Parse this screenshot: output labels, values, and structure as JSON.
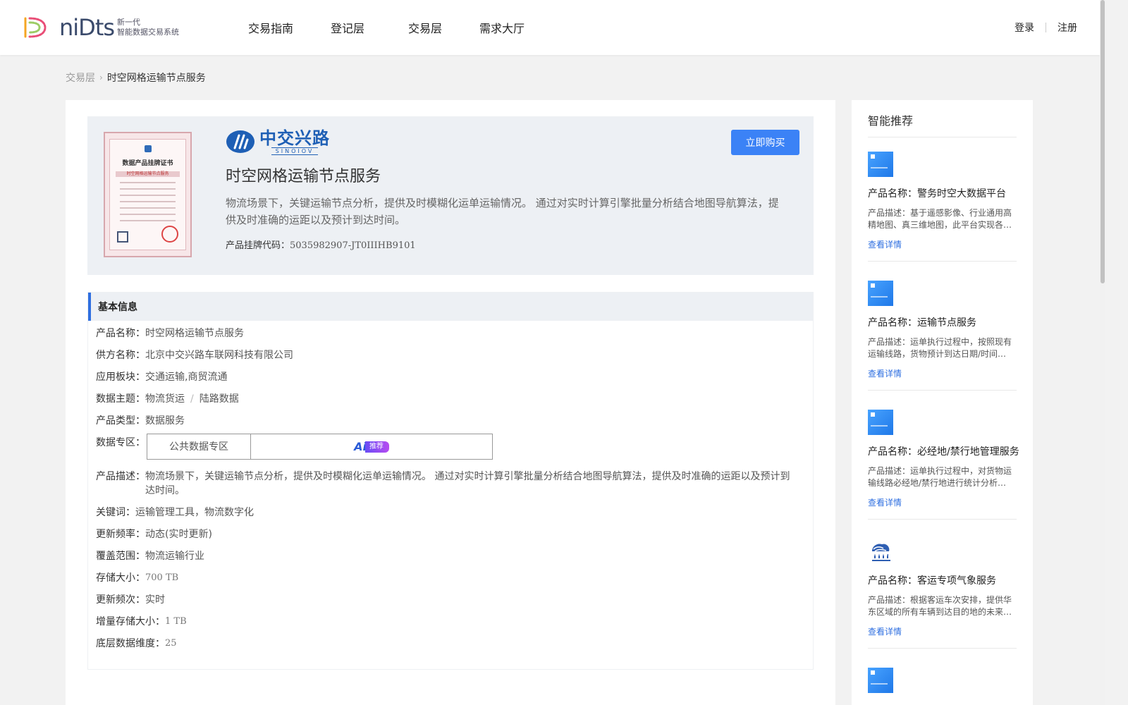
{
  "header": {
    "logo_word": "niDts",
    "logo_sub_1": "新一代",
    "logo_sub_2": "智能数据交易系统",
    "nav": [
      "交易指南",
      "登记层",
      "交易层",
      "需求大厅"
    ],
    "login": "登录",
    "register": "注册"
  },
  "breadcrumb": {
    "parent": "交易层",
    "current": "时空网格运输节点服务"
  },
  "hero": {
    "cert_title": "数据产品挂牌证书",
    "cert_band": "时空网格运输节点服务",
    "brand_cn": "中交兴路",
    "brand_en": "SINOIOV",
    "title": "时空网格运输节点服务",
    "description": "物流场景下，关键运输节点分析，提供及时模糊化运单运输情况。 通过对实时计算引擎批量分析结合地图导航算法，提供及时准确的运距以及预计到达时间。",
    "code_label": "产品挂牌代码：",
    "code_value": "5035982907-JT0IIIHB9101",
    "buy_label": "立即购买"
  },
  "info": {
    "section_title": "基本信息",
    "product_name_label": "产品名称：",
    "product_name": "时空网格运输节点服务",
    "supplier_label": "供方名称：",
    "supplier": "北京中交兴路车联网科技有限公司",
    "sector_label": "应用板块：",
    "sector": "交通运输,商贸流通",
    "theme_label": "数据主题：",
    "theme_1": "物流货运",
    "theme_sep": "/",
    "theme_2": "陆路数据",
    "type_label": "产品类型：",
    "type": "数据服务",
    "zone_label": "数据专区：",
    "zone": "公共数据专区",
    "ai_mark": "Ai",
    "ai_tag": "推荐",
    "desc_label": "产品描述：",
    "desc": "物流场景下，关键运输节点分析，提供及时模糊化运单运输情况。 通过对实时计算引擎批量分析结合地图导航算法，提供及时准确的运距以及预计到达时间。",
    "keywords_label": "关键词：",
    "keywords": "运输管理工具，物流数字化",
    "update_freq_label": "更新频率：",
    "update_freq": "动态(实时更新)",
    "coverage_label": "覆盖范围：",
    "coverage": "物流运输行业",
    "storage_label": "存储大小：",
    "storage": "700 TB",
    "update_times_label": "更新频次：",
    "update_times": "实时",
    "inc_storage_label": "增量存储大小：",
    "inc_storage": "1 TB",
    "dims_label": "底层数据维度：",
    "dims": "25"
  },
  "sidebar": {
    "title": "智能推荐",
    "link_label": "查看详情",
    "items": [
      {
        "name": "产品名称：警务时空大数据平台",
        "desc": "产品描述：基于遥感影像、行业通用高精地图、真三维地图，此平台实现各类警务数据的时空汇聚与分析"
      },
      {
        "name": "产品名称：运输节点服务",
        "desc": "产品描述：运单执行过程中，按照现有运输线路，货物预计到达日期/时间计算服务"
      },
      {
        "name": "产品名称：必经地/禁行地管理服务",
        "desc": "产品描述：运单执行过程中，对货物运输线路必经地/禁行地进行统计分析和管理服务"
      },
      {
        "name": "产品名称：客运专项气象服务",
        "desc": "产品描述：根据客运车次安排，提供华东区域的所有车辆到达目的地的未来天气预报服务"
      }
    ]
  }
}
